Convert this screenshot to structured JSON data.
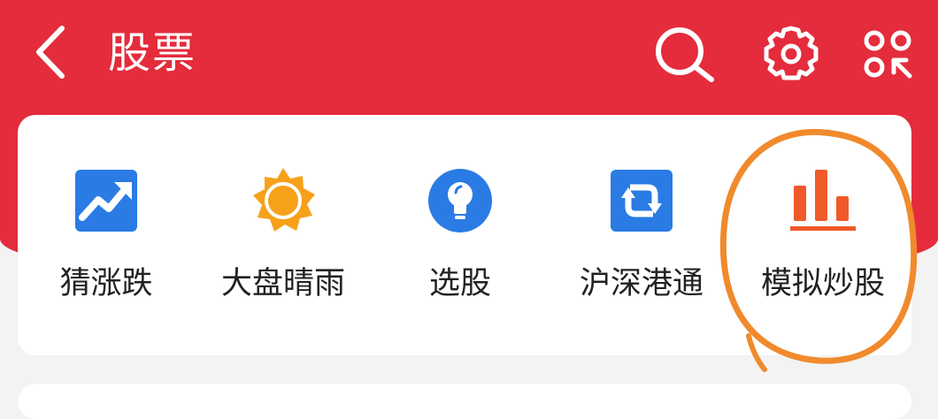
{
  "header": {
    "title": "股票"
  },
  "shortcuts": [
    {
      "label": "猜涨跌",
      "icon": "trend-up-icon"
    },
    {
      "label": "大盘晴雨",
      "icon": "sun-icon"
    },
    {
      "label": "选股",
      "icon": "lightbulb-icon"
    },
    {
      "label": "沪深港通",
      "icon": "exchange-icon"
    },
    {
      "label": "模拟炒股",
      "icon": "bar-chart-icon"
    }
  ],
  "colors": {
    "header_bg": "#e42c3c",
    "blue": "#2a7be4",
    "orange_sun": "#f7a11a",
    "bar_chart": "#f05a2a",
    "highlight_circle": "#f08a2c"
  }
}
